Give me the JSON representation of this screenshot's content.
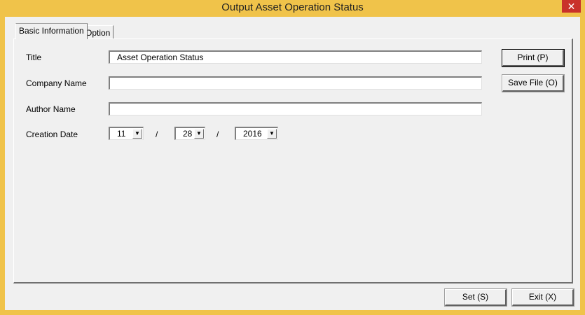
{
  "window": {
    "title": "Output Asset Operation Status",
    "close_glyph": "✕"
  },
  "tabs": [
    {
      "label": "Basic Information",
      "selected": true
    },
    {
      "label": "Option",
      "selected": false
    }
  ],
  "form": {
    "title_label": "Title",
    "title_value": "Asset Operation Status",
    "company_label": "Company Name",
    "company_value": "",
    "author_label": "Author Name",
    "author_value": "",
    "date_label": "Creation Date",
    "month": "11",
    "day": "28",
    "year": "2016",
    "separator": "/"
  },
  "side_buttons": {
    "print_label": "Print (P)",
    "save_label": "Save File (O)"
  },
  "bottom_buttons": {
    "set_label": "Set (S)",
    "exit_label": "Exit (X)"
  },
  "icons": {
    "dropdown": "chevron-down-icon",
    "close": "close-icon"
  },
  "colors": {
    "titlebar": "#f0c34a",
    "close_button": "#c9312a",
    "client": "#f0f0f0"
  }
}
